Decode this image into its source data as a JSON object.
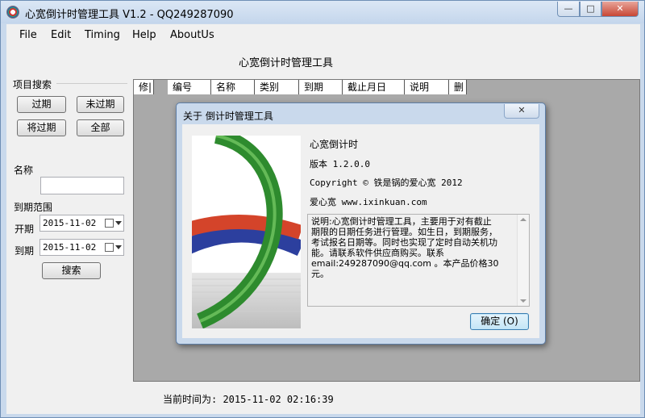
{
  "window": {
    "title": "心宽倒计时管理工具 V1.2 - QQ249287090",
    "min_glyph": "—",
    "max_glyph": "□",
    "close_glyph": "✕"
  },
  "menu": [
    "File",
    "Edit",
    "Timing",
    "Help",
    "AboutUs"
  ],
  "app_heading": "心宽倒计时管理工具",
  "search": {
    "group_title": "项目搜索",
    "buttons": [
      "过期",
      "未过期",
      "将过期",
      "全部"
    ],
    "name_label": "名称",
    "name_value": "",
    "range_label": "到期范围",
    "start_label": "开期",
    "start_date": "2015-11-02",
    "end_label": "到期",
    "end_date": "2015-11-02",
    "search_button": "搜索"
  },
  "grid": {
    "columns": [
      "修|",
      "编号",
      "名称",
      "类别",
      "到期",
      "截止月日",
      "说明",
      "删"
    ]
  },
  "status": {
    "current_time": "当前时间为: 2015-11-02 02:16:39"
  },
  "dialog": {
    "title": "关于 倒计时管理工具",
    "close_glyph": "✕",
    "product_name": "心宽倒计时",
    "version": "版本 1.2.0.0",
    "copyright": "Copyright © 铁是锅的爱心宽  2012",
    "website": "爱心宽 www.ixinkuan.com",
    "description_lines": [
      "说明:心宽倒计时管理工具，主要用于对有截止",
      "期限的日期任务进行管理。如生日，到期服务，",
      "考试报名日期等。同时也实现了定时自动关机功",
      "能。请联系软件供应商购买。联系",
      "email:249287090@qq.com  。本产品价格30元。"
    ],
    "ok_button": "确定 (O)"
  },
  "colors": {
    "logo_green": "#2e8b2e",
    "logo_blue": "#2c3f9e",
    "logo_red": "#d4442a"
  }
}
